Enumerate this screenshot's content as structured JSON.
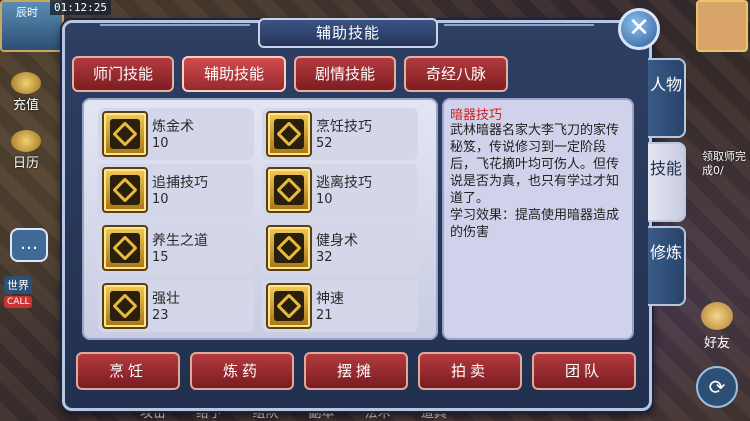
{
  "hud": {
    "clock_label": "辰时",
    "time": "01:12:25",
    "side_buttons": [
      "充值",
      "日历"
    ],
    "world_label": "世界",
    "call_label": "CALL",
    "quest_text": "领取师完成0/",
    "friend_label": "好友",
    "bottom_menu": [
      "攻击",
      "给予",
      "组队",
      "副本",
      "法术",
      "道具"
    ]
  },
  "dialog": {
    "title": "辅助技能",
    "close_symbol": "✕",
    "tabs": [
      {
        "label": "师门技能"
      },
      {
        "label": "辅助技能"
      },
      {
        "label": "剧情技能"
      },
      {
        "label": "奇经八脉"
      }
    ],
    "active_tab": "辅助技能",
    "skills": [
      {
        "name": "炼金术",
        "level": "10"
      },
      {
        "name": "烹饪技巧",
        "level": "52"
      },
      {
        "name": "追捕技巧",
        "level": "10"
      },
      {
        "name": "逃离技巧",
        "level": "10"
      },
      {
        "name": "养生之道",
        "level": "15"
      },
      {
        "name": "健身术",
        "level": "32"
      },
      {
        "name": "强壮",
        "level": "23"
      },
      {
        "name": "神速",
        "level": "21"
      }
    ],
    "description": {
      "title": "暗器技巧",
      "body": "武林暗器名家大李飞刀的家传秘笈，传说修习到一定阶段后，飞花摘叶均可伤人。但传说是否为真，也只有学过才知道了。",
      "effect": "学习效果：提高使用暗器造成的伤害"
    },
    "action_buttons": [
      "烹饪",
      "炼药",
      "摆摊",
      "拍卖",
      "团队"
    ],
    "side_tabs": [
      {
        "label": "人物"
      },
      {
        "label": "技能"
      },
      {
        "label": "修炼"
      }
    ],
    "active_side_tab": "技能"
  },
  "colors": {
    "tab_red": "#962a2e",
    "panel_bg": "#c9cde2",
    "desc_title": "#d0201c"
  }
}
